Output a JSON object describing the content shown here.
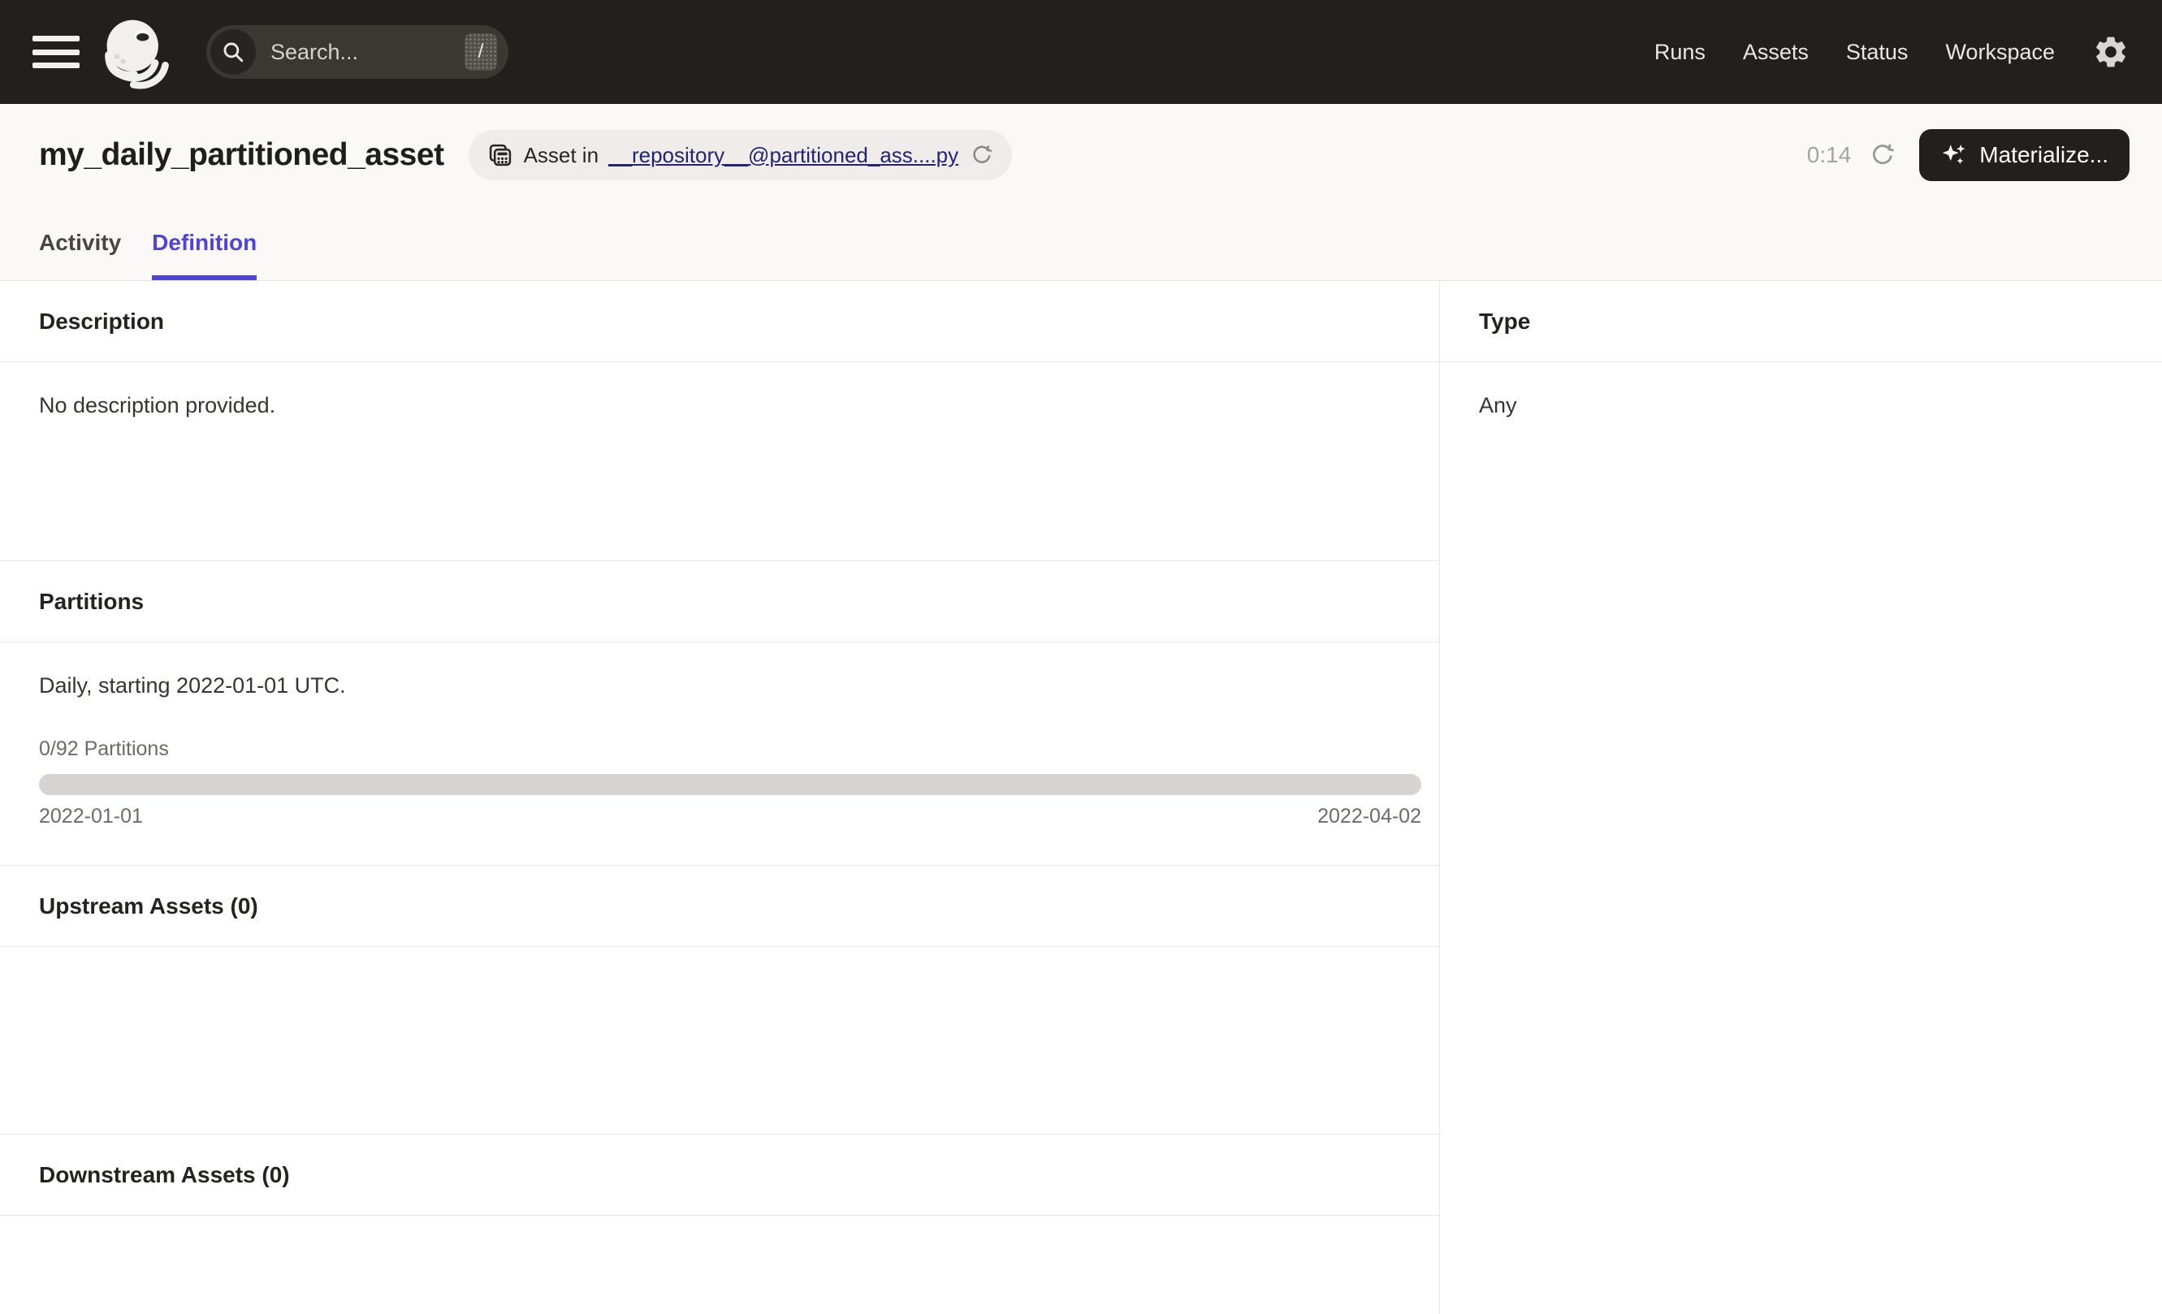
{
  "navbar": {
    "search_placeholder": "Search...",
    "search_shortcut": "/",
    "links": [
      {
        "label": "Runs"
      },
      {
        "label": "Assets"
      },
      {
        "label": "Status"
      },
      {
        "label": "Workspace"
      }
    ]
  },
  "header": {
    "title": "my_daily_partitioned_asset",
    "asset_badge": {
      "prefix": "Asset in",
      "link": "__repository__@partitioned_ass....py"
    },
    "refresh_countdown": "0:14",
    "materialize_label": "Materialize..."
  },
  "tabs": [
    {
      "label": "Activity",
      "active": false
    },
    {
      "label": "Definition",
      "active": true
    }
  ],
  "definition": {
    "description": {
      "heading": "Description",
      "empty_text": "No description provided."
    },
    "partitions": {
      "heading": "Partitions",
      "summary": "Daily, starting 2022-01-01 UTC.",
      "progress_label": "0/92 Partitions",
      "range_start": "2022-01-01",
      "range_end": "2022-04-02"
    },
    "upstream_heading": "Upstream Assets (0)",
    "downstream_heading": "Downstream Assets (0)",
    "type": {
      "heading": "Type",
      "value": "Any"
    }
  },
  "icons": {
    "menu": "hamburger",
    "logo": "dagster-octopus",
    "search": "magnifier",
    "settings": "gear",
    "asset_location": "grid-table",
    "reload": "circular-arrow",
    "materialize": "sparkle"
  },
  "colors": {
    "navbar_bg": "#231F1C",
    "header_bg": "#FAF9F7",
    "accent": "#4F43DD",
    "link": "#232377",
    "divider": "#E7E4E1",
    "progress_track": "#D7D4D1",
    "muted_text": "#6F6A65",
    "badge_bg": "#EFECE9"
  }
}
